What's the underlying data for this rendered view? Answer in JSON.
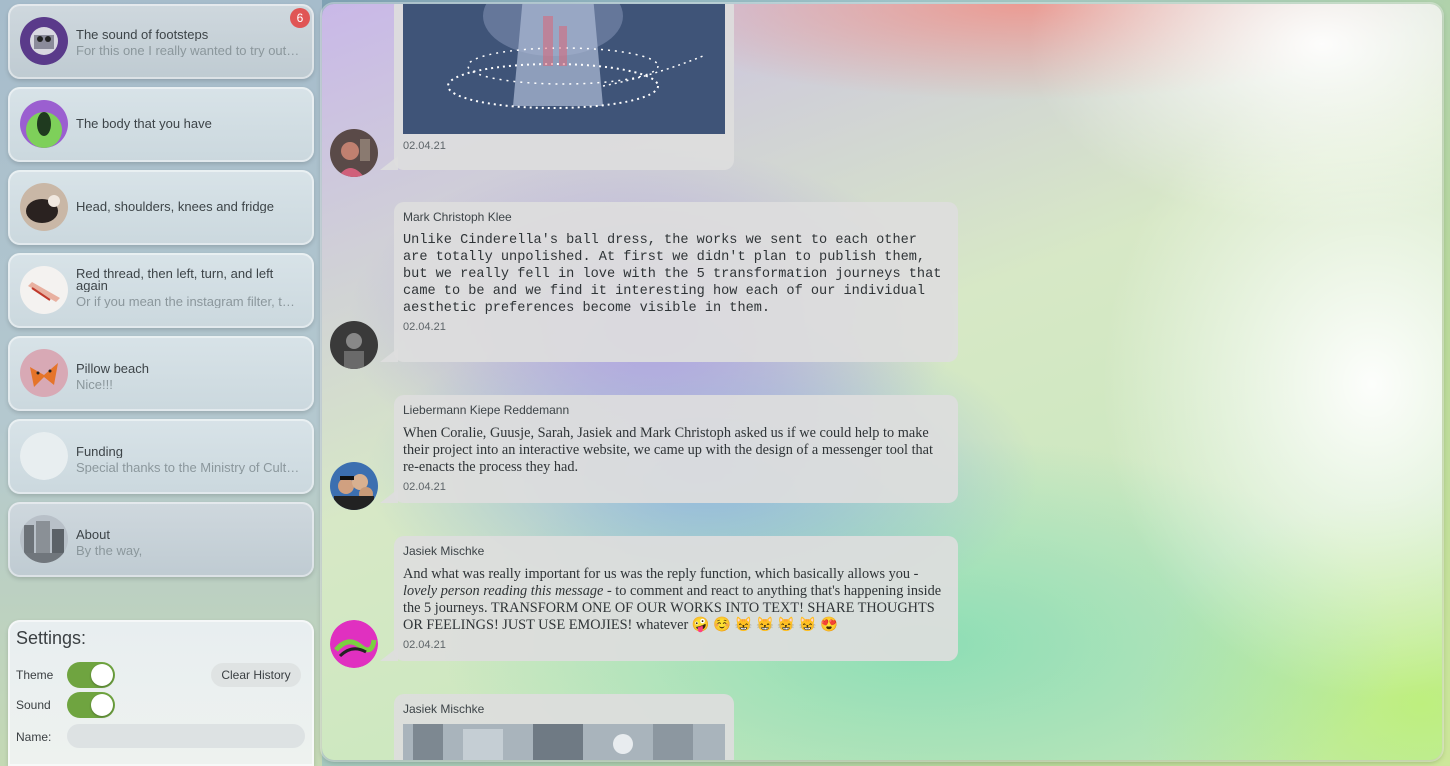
{
  "sidebar": {
    "items": [
      {
        "title": "The sound of footsteps",
        "subtitle": "For this one I really wanted to try out something",
        "badge": "6"
      },
      {
        "title": "The body that you have",
        "subtitle": ""
      },
      {
        "title": "Head, shoulders, knees and fridge",
        "subtitle": ""
      },
      {
        "title": "Red thread, then left, turn, and left again",
        "subtitle": "Or if you mean the instagram filter, that one"
      },
      {
        "title": "Pillow beach",
        "subtitle": "Nice!!!"
      },
      {
        "title": "Funding",
        "subtitle": "Special thanks to the Ministry of Culture"
      },
      {
        "title": "About",
        "subtitle": "By the way,"
      }
    ]
  },
  "settings": {
    "title": "Settings:",
    "theme_label": "Theme",
    "theme_on": true,
    "sound_label": "Sound",
    "sound_on": true,
    "clear_history_label": "Clear History",
    "name_label": "Name:",
    "name_value": ""
  },
  "messages": [
    {
      "sender": "",
      "text": "",
      "date": "02.04.21",
      "has_image": true
    },
    {
      "sender": "Mark Christoph Klee",
      "text": "Unlike Cinderella's ball dress, the works we sent to each other are totally unpolished. At first we didn't plan to publish them, but we really fell in love with the 5 transformation journeys that came to be and we find it interesting how each of our individual aesthetic preferences become visible in them.",
      "date": "02.04.21"
    },
    {
      "sender": "Liebermann Kiepe Reddemann",
      "text": "When Coralie, Guusje, Sarah, Jasiek and Mark Christoph asked us if we could help to make their project into an interactive website, we came up with the design of a messenger tool that re-enacts the process they had.",
      "date": "02.04.21"
    },
    {
      "sender": "Jasiek Mischke",
      "text_before": "And what was really important for us was the reply function, which basically allows you - ",
      "text_italic": "lovely person reading this message",
      "text_after": " - to comment and react to anything that's happening inside the 5 journeys. TRANSFORM ONE OF OUR WORKS INTO TEXT! SHARE THOUGHTS OR FEELINGS! JUST USE EMOJIES! whatever 🤪 ☺️ 😸 😸 😸 😸 😍",
      "date": "02.04.21"
    },
    {
      "sender": "Jasiek Mischke",
      "text": "",
      "date": "",
      "has_image": true
    }
  ],
  "colors": {
    "toggle_on": "#6fa440",
    "badge": "#e05555",
    "bubble": "#dddddd"
  }
}
